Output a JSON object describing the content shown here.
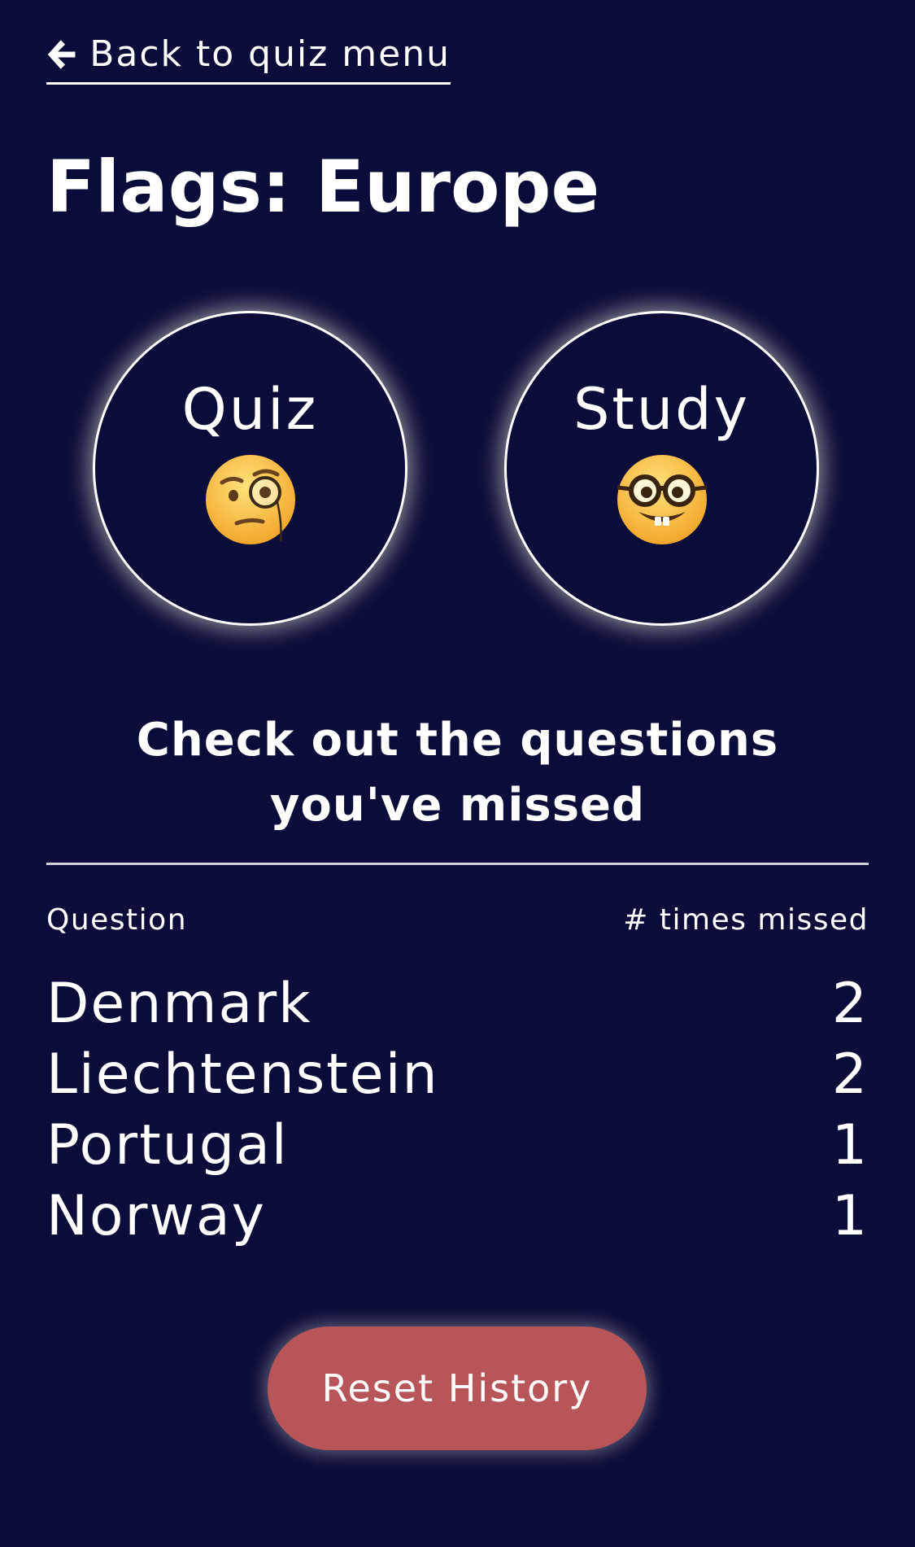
{
  "nav": {
    "back_label": "Back to quiz menu",
    "back_icon": "arrow-left-icon"
  },
  "page": {
    "title": "Flags: Europe",
    "background_color": "#0c0c3a"
  },
  "modes": [
    {
      "label": "Quiz",
      "icon": "monocle-face-icon"
    },
    {
      "label": "Study",
      "icon": "nerd-face-icon"
    }
  ],
  "missed": {
    "heading": "Check out the questions you've missed",
    "column_question": "Question",
    "column_count": "# times missed",
    "rows": [
      {
        "question": "Denmark",
        "count": "2"
      },
      {
        "question": "Liechtenstein",
        "count": "2"
      },
      {
        "question": "Portugal",
        "count": "1"
      },
      {
        "question": "Norway",
        "count": "1"
      }
    ]
  },
  "actions": {
    "reset_label": "Reset History",
    "reset_color": "#b85558"
  }
}
